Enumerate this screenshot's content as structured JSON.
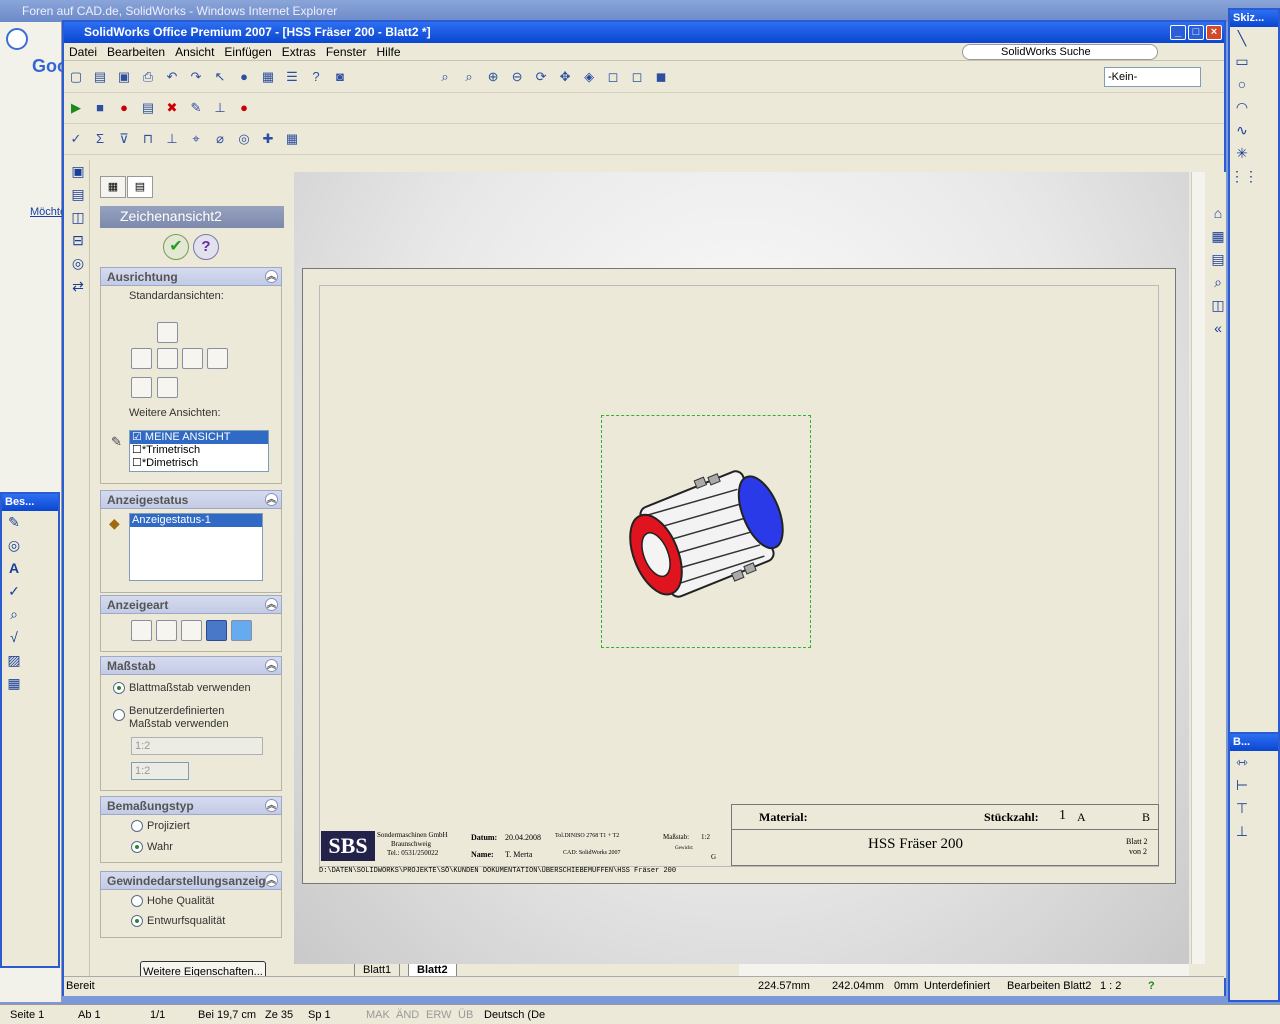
{
  "ie": {
    "title": "Foren auf CAD.de, SolidWorks - Windows Internet Explorer",
    "tab_label": "Fo",
    "side_link": "Möchte"
  },
  "sw": {
    "title": "SolidWorks Office Premium 2007 - [HSS Fräser 200 - Blatt2 *]",
    "menu": [
      "Datei",
      "Bearbeiten",
      "Ansicht",
      "Einfügen",
      "Extras",
      "Fenster",
      "Hilfe"
    ],
    "search_label": "SolidWorks Suche",
    "layer_select": "-Kein-"
  },
  "panel": {
    "title": "Zeichenansicht2",
    "ausrichtung": {
      "header": "Ausrichtung",
      "standard_label": "Standardansichten:",
      "weitere_label": "Weitere Ansichten:",
      "views": [
        {
          "label": "MEINE ANSICHT",
          "checked": true
        },
        {
          "label": "*Trimetrisch",
          "checked": false
        },
        {
          "label": "*Dimetrisch",
          "checked": false
        }
      ]
    },
    "anzeigestatus": {
      "header": "Anzeigestatus",
      "items": [
        "Anzeigestatus-1"
      ]
    },
    "anzeigeart": {
      "header": "Anzeigeart"
    },
    "massstab": {
      "header": "Maßstab",
      "opt1": "Blattmaßstab verwenden",
      "opt2_line1": "Benutzerdefinierten",
      "opt2_line2": "Maßstab verwenden",
      "select_value": "1:2",
      "input_value": "1:2"
    },
    "bemassungstyp": {
      "header": "Bemaßungstyp",
      "opt1": "Projiziert",
      "opt2": "Wahr"
    },
    "gewinde": {
      "header": "Gewindedarstellungsanzeige",
      "opt1": "Hohe Qualität",
      "opt2": "Entwurfsqualität"
    },
    "more_button": "Weitere Eigenschaften..."
  },
  "titleblock": {
    "material_label": "Material:",
    "stueck_label": "Stückzahl:",
    "stueck_value": "1",
    "col_a": "A",
    "col_b": "B",
    "part_name": "HSS Fräser 200",
    "blatt": "Blatt 2",
    "von": "von 2",
    "logo": "SBS",
    "company_line1": "Sondermaschinen GmbH",
    "company_line2": "Braunschweig",
    "company_tel": "Tel.: 0531/250022",
    "datum_label": "Datum:",
    "datum_value": "20.04.2008",
    "tol_label": "Tol.DINISO 2768 T1 + T2",
    "massstab_label": "Maßstab:",
    "massstab_value": "1:2",
    "name_label": "Name:",
    "name_value": "T. Merta",
    "cad_label": "CAD: SolidWorks 2007",
    "gewicht_label": "Gewicht:",
    "gewicht_value": "G",
    "path": "D:\\DATEN\\SOLIDWORKS\\PROJEKTE\\SÖ\\KUNDEN DOKUMENTATION\\ÜBERSCHIEBEMUFFEN\\HSS Fräser 200"
  },
  "sheet_tabs": [
    "Blatt1",
    "Blatt2"
  ],
  "status": {
    "left": "Bereit",
    "x": "224.57mm",
    "y": "242.04mm",
    "z": "0mm",
    "state": "Unterdefiniert",
    "edit": "Bearbeiten Blatt2",
    "scale": "1 : 2",
    "help": "?"
  },
  "word_status": {
    "seite": "Seite 1",
    "ab": "Ab 1",
    "pages": "1/1",
    "bei": "Bei 19,7 cm",
    "ze": "Ze 35",
    "sp": "Sp 1",
    "mak": "MAK",
    "aend": "ÄND",
    "erw": "ERW",
    "ueb": "ÜB",
    "lang": "Deutsch (De"
  },
  "float_left_title": "Bes...",
  "float_right_top_title": "Skiz...",
  "float_right_bottom_title": "B...",
  "colors": {
    "xp_blue": "#0a46d0",
    "red_face": "#e0141e",
    "blue_face": "#2a3ae8",
    "selection": "#316ac5"
  }
}
